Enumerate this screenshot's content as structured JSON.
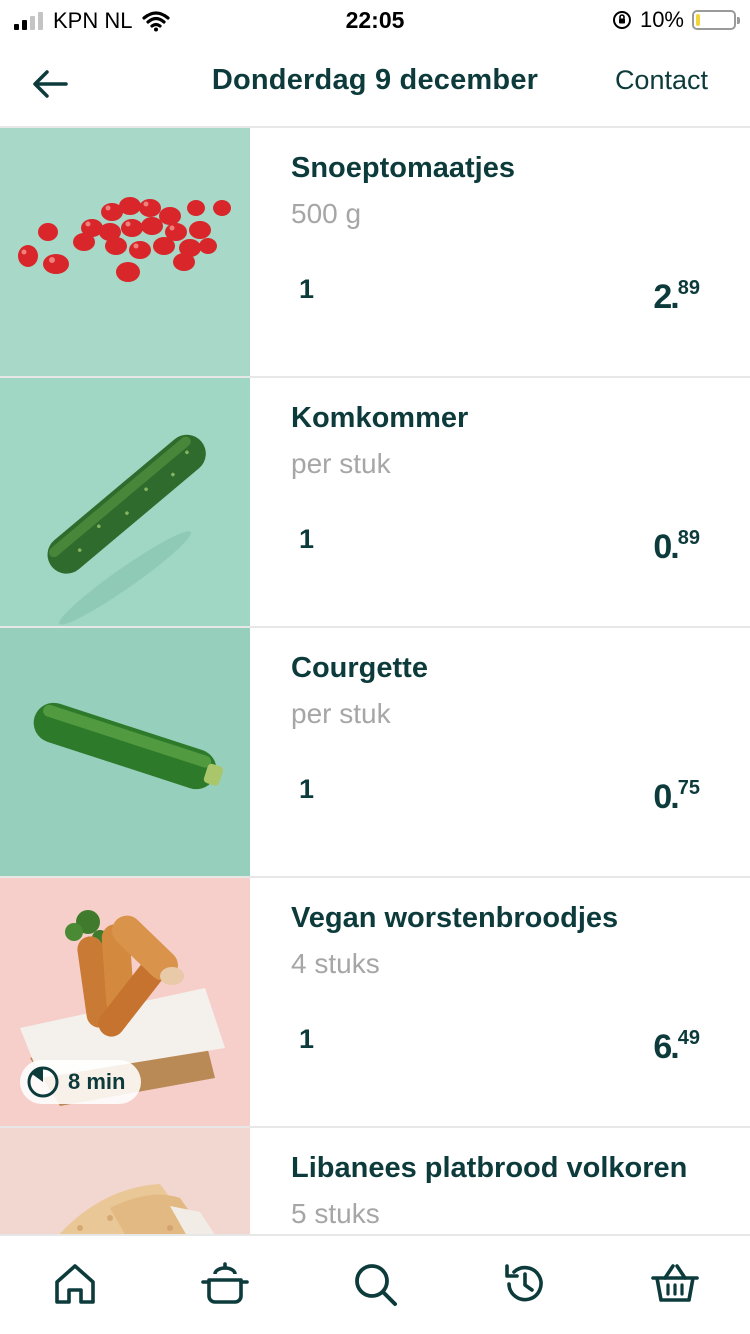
{
  "status": {
    "carrier": "KPN NL",
    "time": "22:05",
    "battery": "10%",
    "battery_level": 0.1
  },
  "header": {
    "title": "Donderdag 9 december",
    "contact": "Contact"
  },
  "products": [
    {
      "name": "Snoeptomaatjes",
      "unit": "500 g",
      "qty": "1",
      "price_euros": "2",
      "price_cents": "89"
    },
    {
      "name": "Komkommer",
      "unit": "per stuk",
      "qty": "1",
      "price_euros": "0",
      "price_cents": "89"
    },
    {
      "name": "Courgette",
      "unit": "per stuk",
      "qty": "1",
      "price_euros": "0",
      "price_cents": "75"
    },
    {
      "name": "Vegan worstenbroodjes",
      "unit": "4 stuks",
      "qty": "1",
      "price_euros": "6",
      "price_cents": "49",
      "prep_time": "8 min"
    },
    {
      "name": "Libanees platbrood volkoren",
      "unit": "5 stuks"
    }
  ],
  "tabs": [
    "home-icon",
    "pot-icon",
    "search-icon",
    "history-icon",
    "basket-icon"
  ],
  "colors": {
    "brand": "#0d3b3b",
    "mint": "#9fd6c4",
    "blush": "#f6cfca"
  }
}
